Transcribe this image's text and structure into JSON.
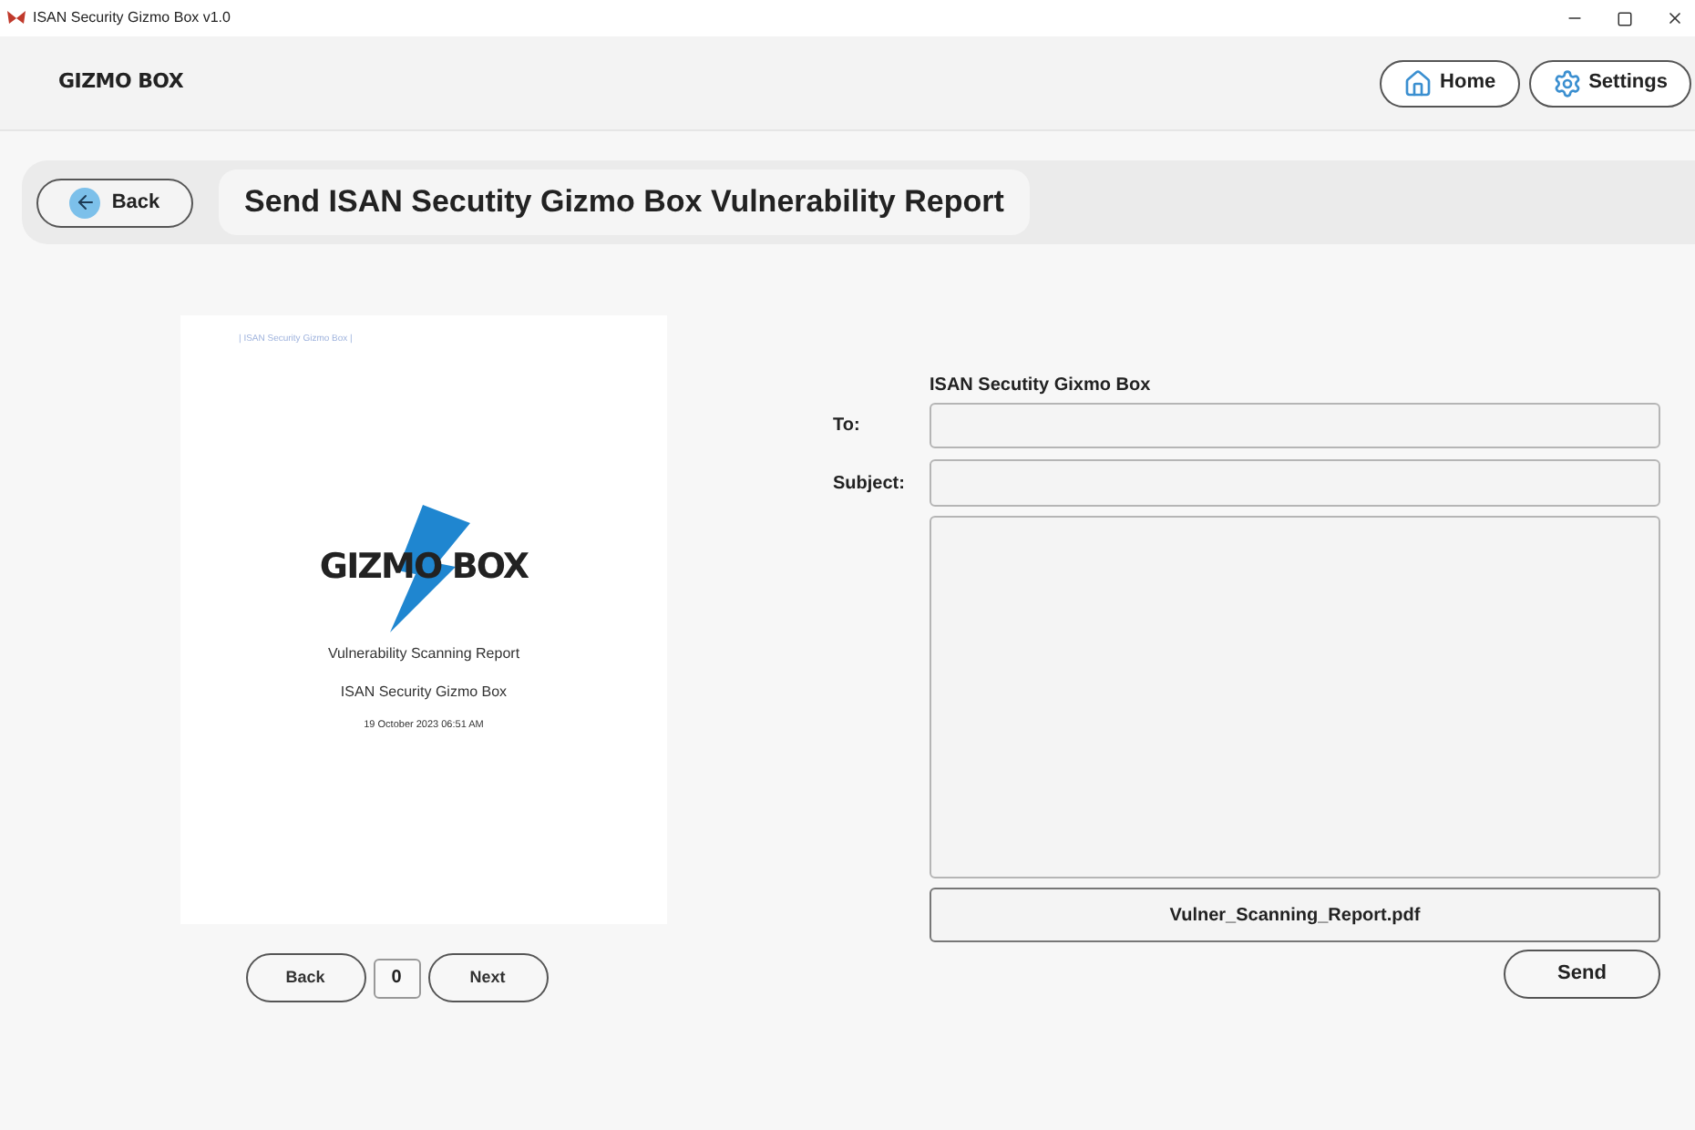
{
  "window": {
    "title": "ISAN Security Gizmo Box v1.0"
  },
  "header": {
    "logo": "GIZMO BOX",
    "buttons": [
      {
        "label": "Home",
        "kind": "home"
      },
      {
        "label": "Settings",
        "kind": "settings"
      }
    ]
  },
  "nav": {
    "back": "Back",
    "title": "Send ISAN Secutity Gizmo Box Vulnerability Report"
  },
  "preview": {
    "page_header": "| ISAN Security Gizmo Box |",
    "logo": "GIZMO BOX",
    "title": "Vulnerability Scanning Report",
    "subtitle": "ISAN Security Gizmo Box",
    "date": "19 October 2023 06:51 AM"
  },
  "pager": {
    "back": "Back",
    "page": "0",
    "next": "Next"
  },
  "form": {
    "sender": "ISAN Secutity Gixmo Box",
    "to_label": "To:",
    "subject_label": "Subject:",
    "attachment": "Vulner_Scanning_Report.pdf",
    "send": "Send"
  }
}
